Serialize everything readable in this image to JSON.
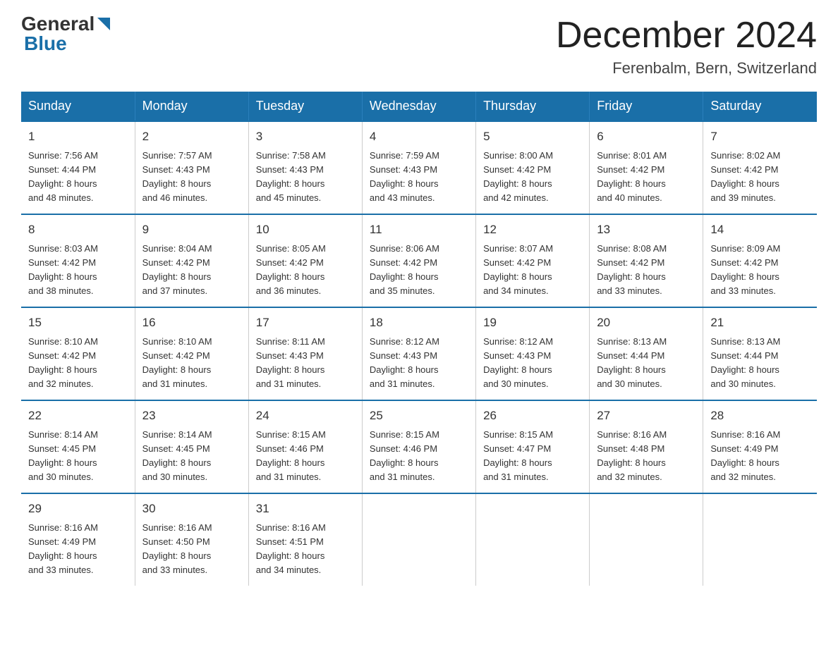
{
  "logo": {
    "general": "General",
    "blue": "Blue"
  },
  "title": "December 2024",
  "location": "Ferenbalm, Bern, Switzerland",
  "weekdays": [
    "Sunday",
    "Monday",
    "Tuesday",
    "Wednesday",
    "Thursday",
    "Friday",
    "Saturday"
  ],
  "weeks": [
    [
      {
        "day": "1",
        "sunrise": "7:56 AM",
        "sunset": "4:44 PM",
        "daylight": "8 hours and 48 minutes."
      },
      {
        "day": "2",
        "sunrise": "7:57 AM",
        "sunset": "4:43 PM",
        "daylight": "8 hours and 46 minutes."
      },
      {
        "day": "3",
        "sunrise": "7:58 AM",
        "sunset": "4:43 PM",
        "daylight": "8 hours and 45 minutes."
      },
      {
        "day": "4",
        "sunrise": "7:59 AM",
        "sunset": "4:43 PM",
        "daylight": "8 hours and 43 minutes."
      },
      {
        "day": "5",
        "sunrise": "8:00 AM",
        "sunset": "4:42 PM",
        "daylight": "8 hours and 42 minutes."
      },
      {
        "day": "6",
        "sunrise": "8:01 AM",
        "sunset": "4:42 PM",
        "daylight": "8 hours and 40 minutes."
      },
      {
        "day": "7",
        "sunrise": "8:02 AM",
        "sunset": "4:42 PM",
        "daylight": "8 hours and 39 minutes."
      }
    ],
    [
      {
        "day": "8",
        "sunrise": "8:03 AM",
        "sunset": "4:42 PM",
        "daylight": "8 hours and 38 minutes."
      },
      {
        "day": "9",
        "sunrise": "8:04 AM",
        "sunset": "4:42 PM",
        "daylight": "8 hours and 37 minutes."
      },
      {
        "day": "10",
        "sunrise": "8:05 AM",
        "sunset": "4:42 PM",
        "daylight": "8 hours and 36 minutes."
      },
      {
        "day": "11",
        "sunrise": "8:06 AM",
        "sunset": "4:42 PM",
        "daylight": "8 hours and 35 minutes."
      },
      {
        "day": "12",
        "sunrise": "8:07 AM",
        "sunset": "4:42 PM",
        "daylight": "8 hours and 34 minutes."
      },
      {
        "day": "13",
        "sunrise": "8:08 AM",
        "sunset": "4:42 PM",
        "daylight": "8 hours and 33 minutes."
      },
      {
        "day": "14",
        "sunrise": "8:09 AM",
        "sunset": "4:42 PM",
        "daylight": "8 hours and 33 minutes."
      }
    ],
    [
      {
        "day": "15",
        "sunrise": "8:10 AM",
        "sunset": "4:42 PM",
        "daylight": "8 hours and 32 minutes."
      },
      {
        "day": "16",
        "sunrise": "8:10 AM",
        "sunset": "4:42 PM",
        "daylight": "8 hours and 31 minutes."
      },
      {
        "day": "17",
        "sunrise": "8:11 AM",
        "sunset": "4:43 PM",
        "daylight": "8 hours and 31 minutes."
      },
      {
        "day": "18",
        "sunrise": "8:12 AM",
        "sunset": "4:43 PM",
        "daylight": "8 hours and 31 minutes."
      },
      {
        "day": "19",
        "sunrise": "8:12 AM",
        "sunset": "4:43 PM",
        "daylight": "8 hours and 30 minutes."
      },
      {
        "day": "20",
        "sunrise": "8:13 AM",
        "sunset": "4:44 PM",
        "daylight": "8 hours and 30 minutes."
      },
      {
        "day": "21",
        "sunrise": "8:13 AM",
        "sunset": "4:44 PM",
        "daylight": "8 hours and 30 minutes."
      }
    ],
    [
      {
        "day": "22",
        "sunrise": "8:14 AM",
        "sunset": "4:45 PM",
        "daylight": "8 hours and 30 minutes."
      },
      {
        "day": "23",
        "sunrise": "8:14 AM",
        "sunset": "4:45 PM",
        "daylight": "8 hours and 30 minutes."
      },
      {
        "day": "24",
        "sunrise": "8:15 AM",
        "sunset": "4:46 PM",
        "daylight": "8 hours and 31 minutes."
      },
      {
        "day": "25",
        "sunrise": "8:15 AM",
        "sunset": "4:46 PM",
        "daylight": "8 hours and 31 minutes."
      },
      {
        "day": "26",
        "sunrise": "8:15 AM",
        "sunset": "4:47 PM",
        "daylight": "8 hours and 31 minutes."
      },
      {
        "day": "27",
        "sunrise": "8:16 AM",
        "sunset": "4:48 PM",
        "daylight": "8 hours and 32 minutes."
      },
      {
        "day": "28",
        "sunrise": "8:16 AM",
        "sunset": "4:49 PM",
        "daylight": "8 hours and 32 minutes."
      }
    ],
    [
      {
        "day": "29",
        "sunrise": "8:16 AM",
        "sunset": "4:49 PM",
        "daylight": "8 hours and 33 minutes."
      },
      {
        "day": "30",
        "sunrise": "8:16 AM",
        "sunset": "4:50 PM",
        "daylight": "8 hours and 33 minutes."
      },
      {
        "day": "31",
        "sunrise": "8:16 AM",
        "sunset": "4:51 PM",
        "daylight": "8 hours and 34 minutes."
      },
      null,
      null,
      null,
      null
    ]
  ],
  "labels": {
    "sunrise_prefix": "Sunrise: ",
    "sunset_prefix": "Sunset: ",
    "daylight_prefix": "Daylight: "
  }
}
